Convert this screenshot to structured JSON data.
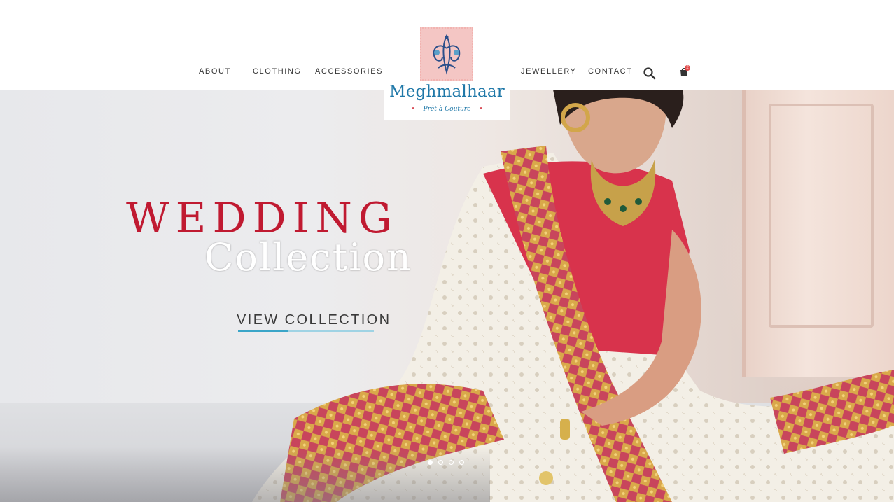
{
  "nav": {
    "left": [
      "ABOUT",
      "CLOTHING",
      "ACCESSORIES"
    ],
    "right": [
      "JEWELLERY",
      "CONTACT"
    ],
    "search_icon": "search-icon",
    "cart_icon": "shopping-bag-icon",
    "cart_count": "2"
  },
  "logo": {
    "name": "Meghmalhaar",
    "tagline": "Prêt-à-Couture",
    "colors": {
      "text": "#1f78a8",
      "stamp": "#f4c6c4",
      "accent": "#d94e59"
    }
  },
  "hero": {
    "headline_line1": "WEDDING",
    "headline_line2": "Collection",
    "cta_label": "VIEW COLLECTION",
    "slides_total": 4,
    "active_slide": 1,
    "colors": {
      "headline": "#c01a31",
      "cta_accent": "#3aa5c8"
    }
  }
}
